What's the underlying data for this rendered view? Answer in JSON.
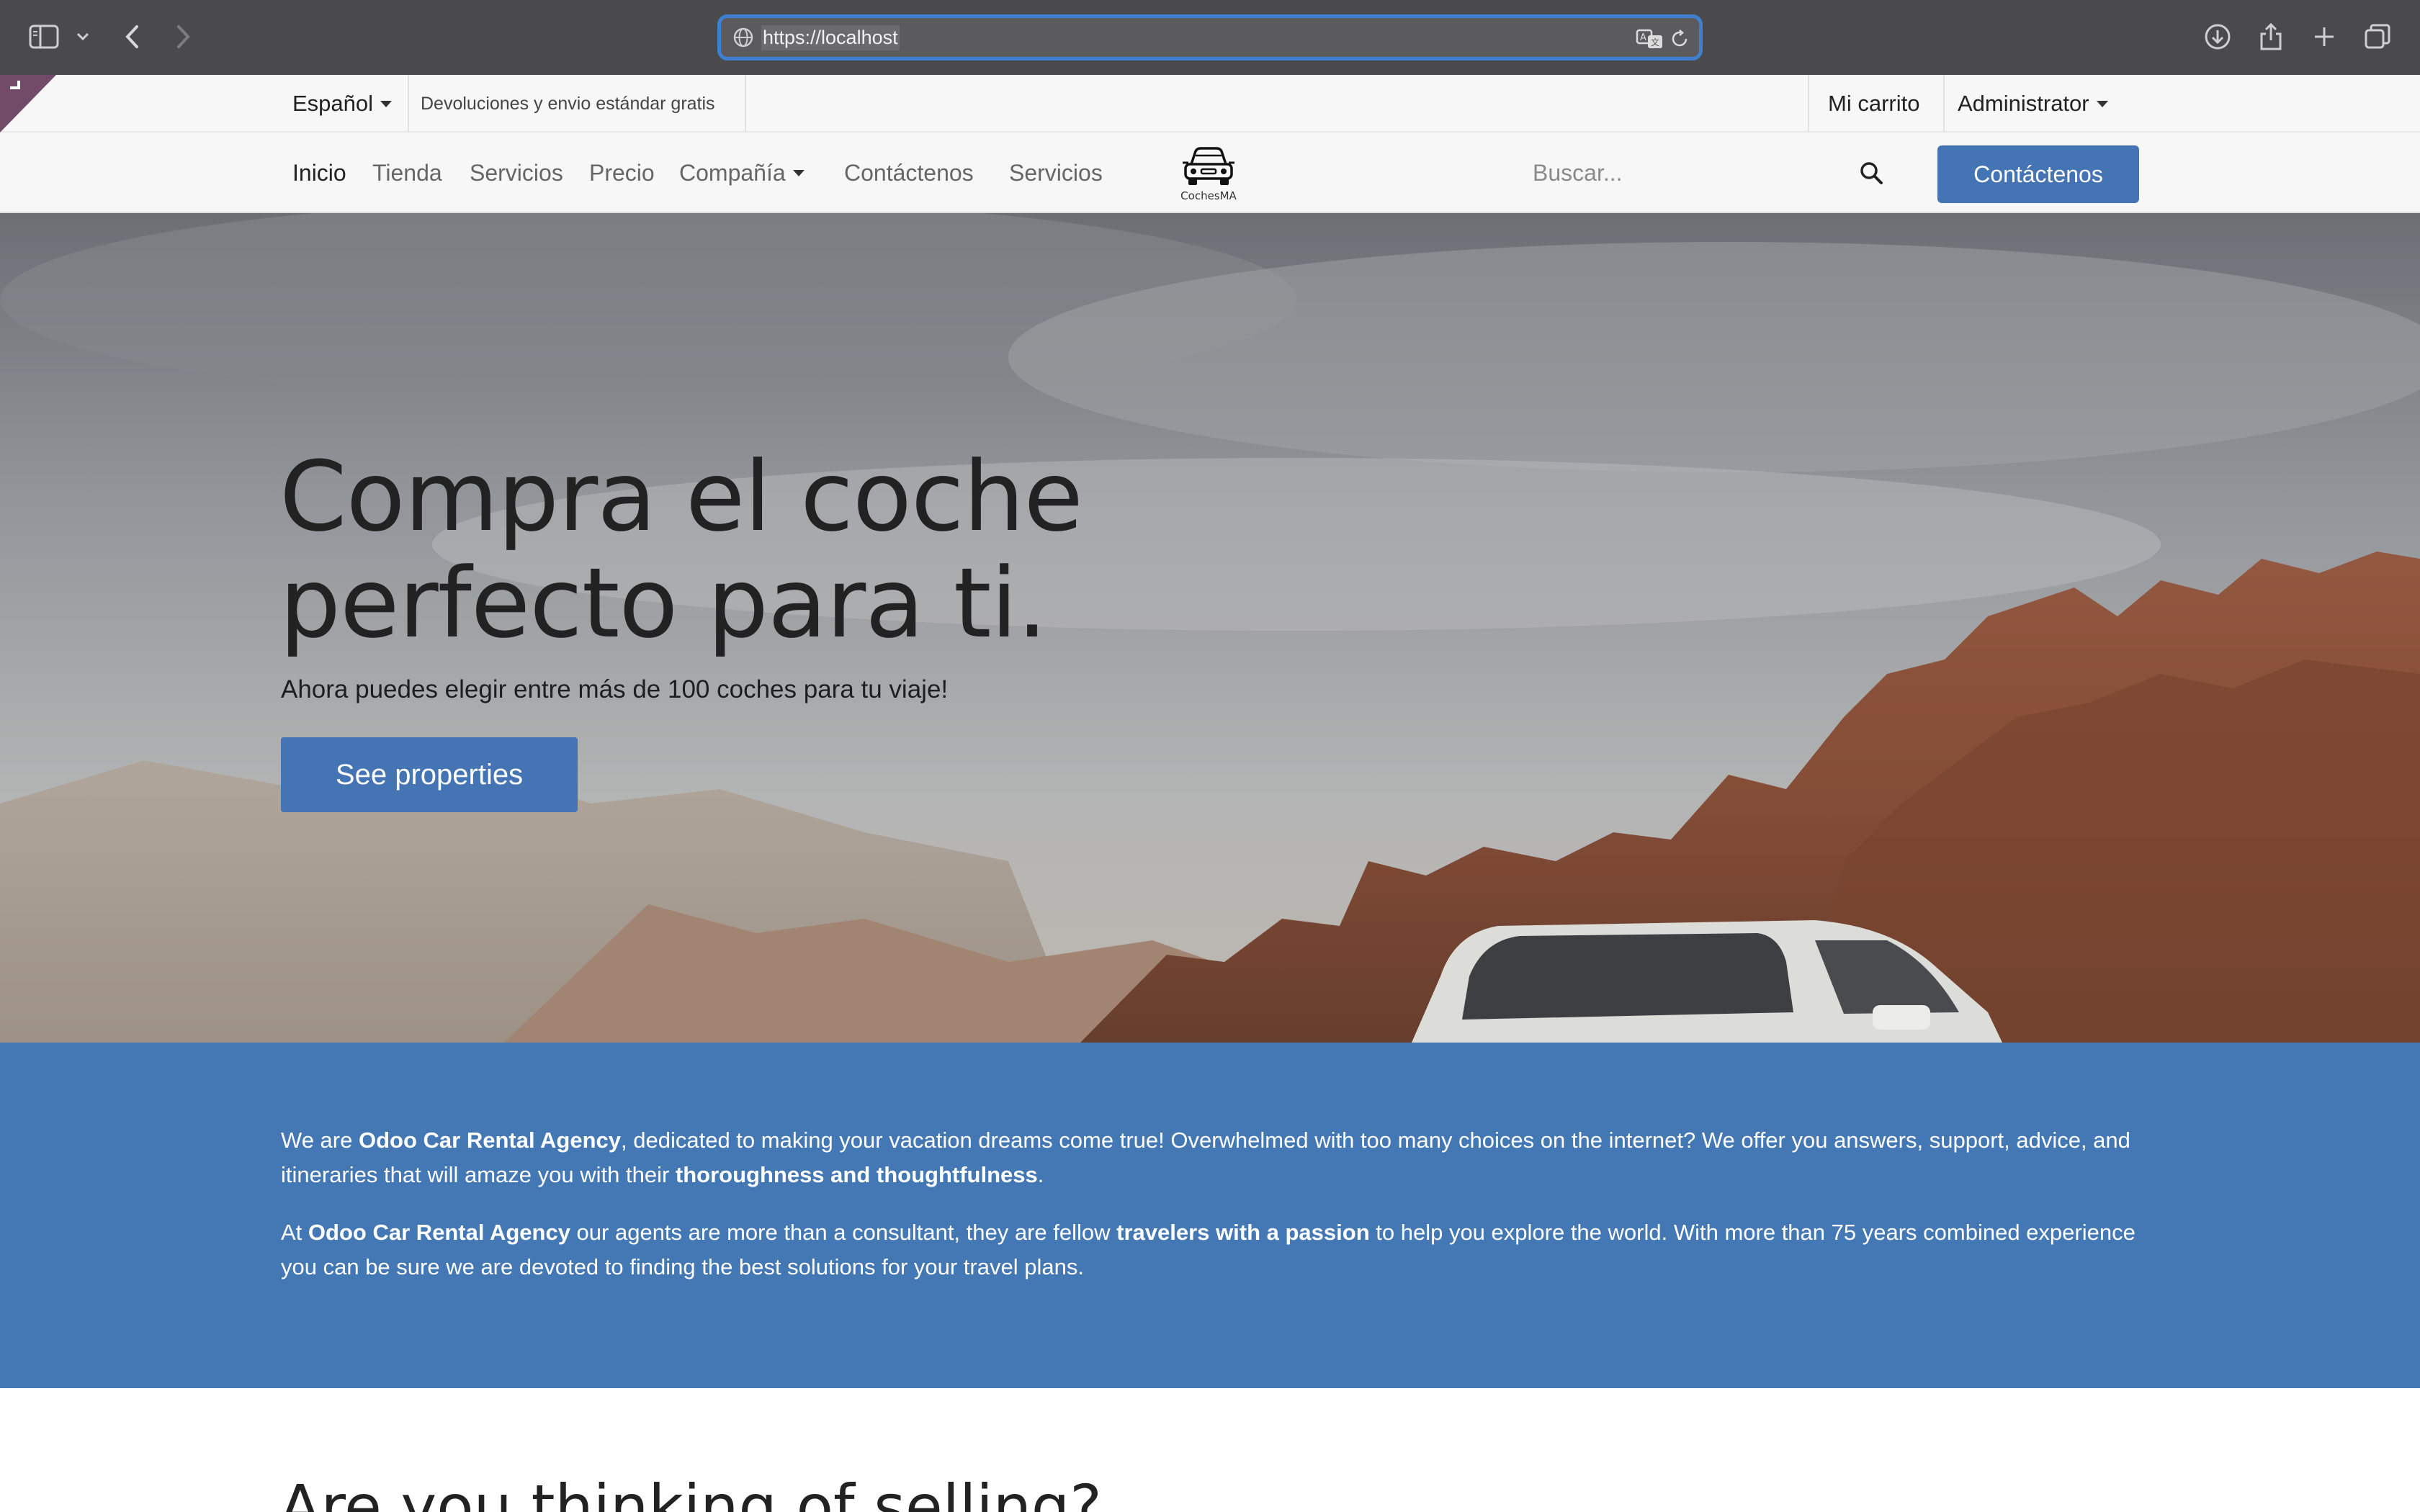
{
  "browser": {
    "url": "https://localhost"
  },
  "topbar": {
    "language": "Español",
    "promo": "Devoluciones y envio estándar gratis",
    "cart": "Mi carrito",
    "user": "Administrator"
  },
  "nav": {
    "items": [
      "Inicio",
      "Tienda",
      "Servicios",
      "Precio",
      "Compañía",
      "Contáctenos",
      "Servicios"
    ],
    "logo_text": "CochesMA",
    "search_placeholder": "Buscar...",
    "cta": "Contáctenos"
  },
  "hero": {
    "title_line1": "Compra el coche",
    "title_line2": "perfecto para ti.",
    "subtitle": "Ahora puedes elegir entre más de 100 coches para tu viaje!",
    "button": "See properties"
  },
  "intro": {
    "p1": {
      "t1": "We are ",
      "b1": "Odoo Car Rental Agency",
      "t2": ", dedicated to making your vacation dreams come true! Overwhelmed with too many choices on the internet? We offer you answers, support, advice, and itineraries that will amaze you with their ",
      "b2": "thoroughness and thoughtfulness",
      "t3": "."
    },
    "p2": {
      "t1": "At ",
      "b1": "Odoo Car Rental Agency",
      "t2": " our agents are more than a consultant, they are fellow ",
      "b2": "travelers with a passion",
      "t3": " to help you explore the world. With more than 75 years combined experience you can be sure we are devoted to finding the best solutions for your travel plans."
    }
  },
  "selling": {
    "title": "Are you thinking of selling?"
  },
  "colors": {
    "brand_blue": "#4474b4",
    "intro_blue": "#4478b4",
    "chrome": "#4a4a4c",
    "url_focus": "#3f7fd0"
  },
  "icons": [
    "sidebar-icon",
    "chevron-down-icon",
    "back-arrow-icon",
    "forward-arrow-icon",
    "globe-icon",
    "translate-icon",
    "reload-icon",
    "download-icon",
    "share-icon",
    "plus-icon",
    "tabs-icon",
    "search-icon",
    "car-logo-icon"
  ]
}
